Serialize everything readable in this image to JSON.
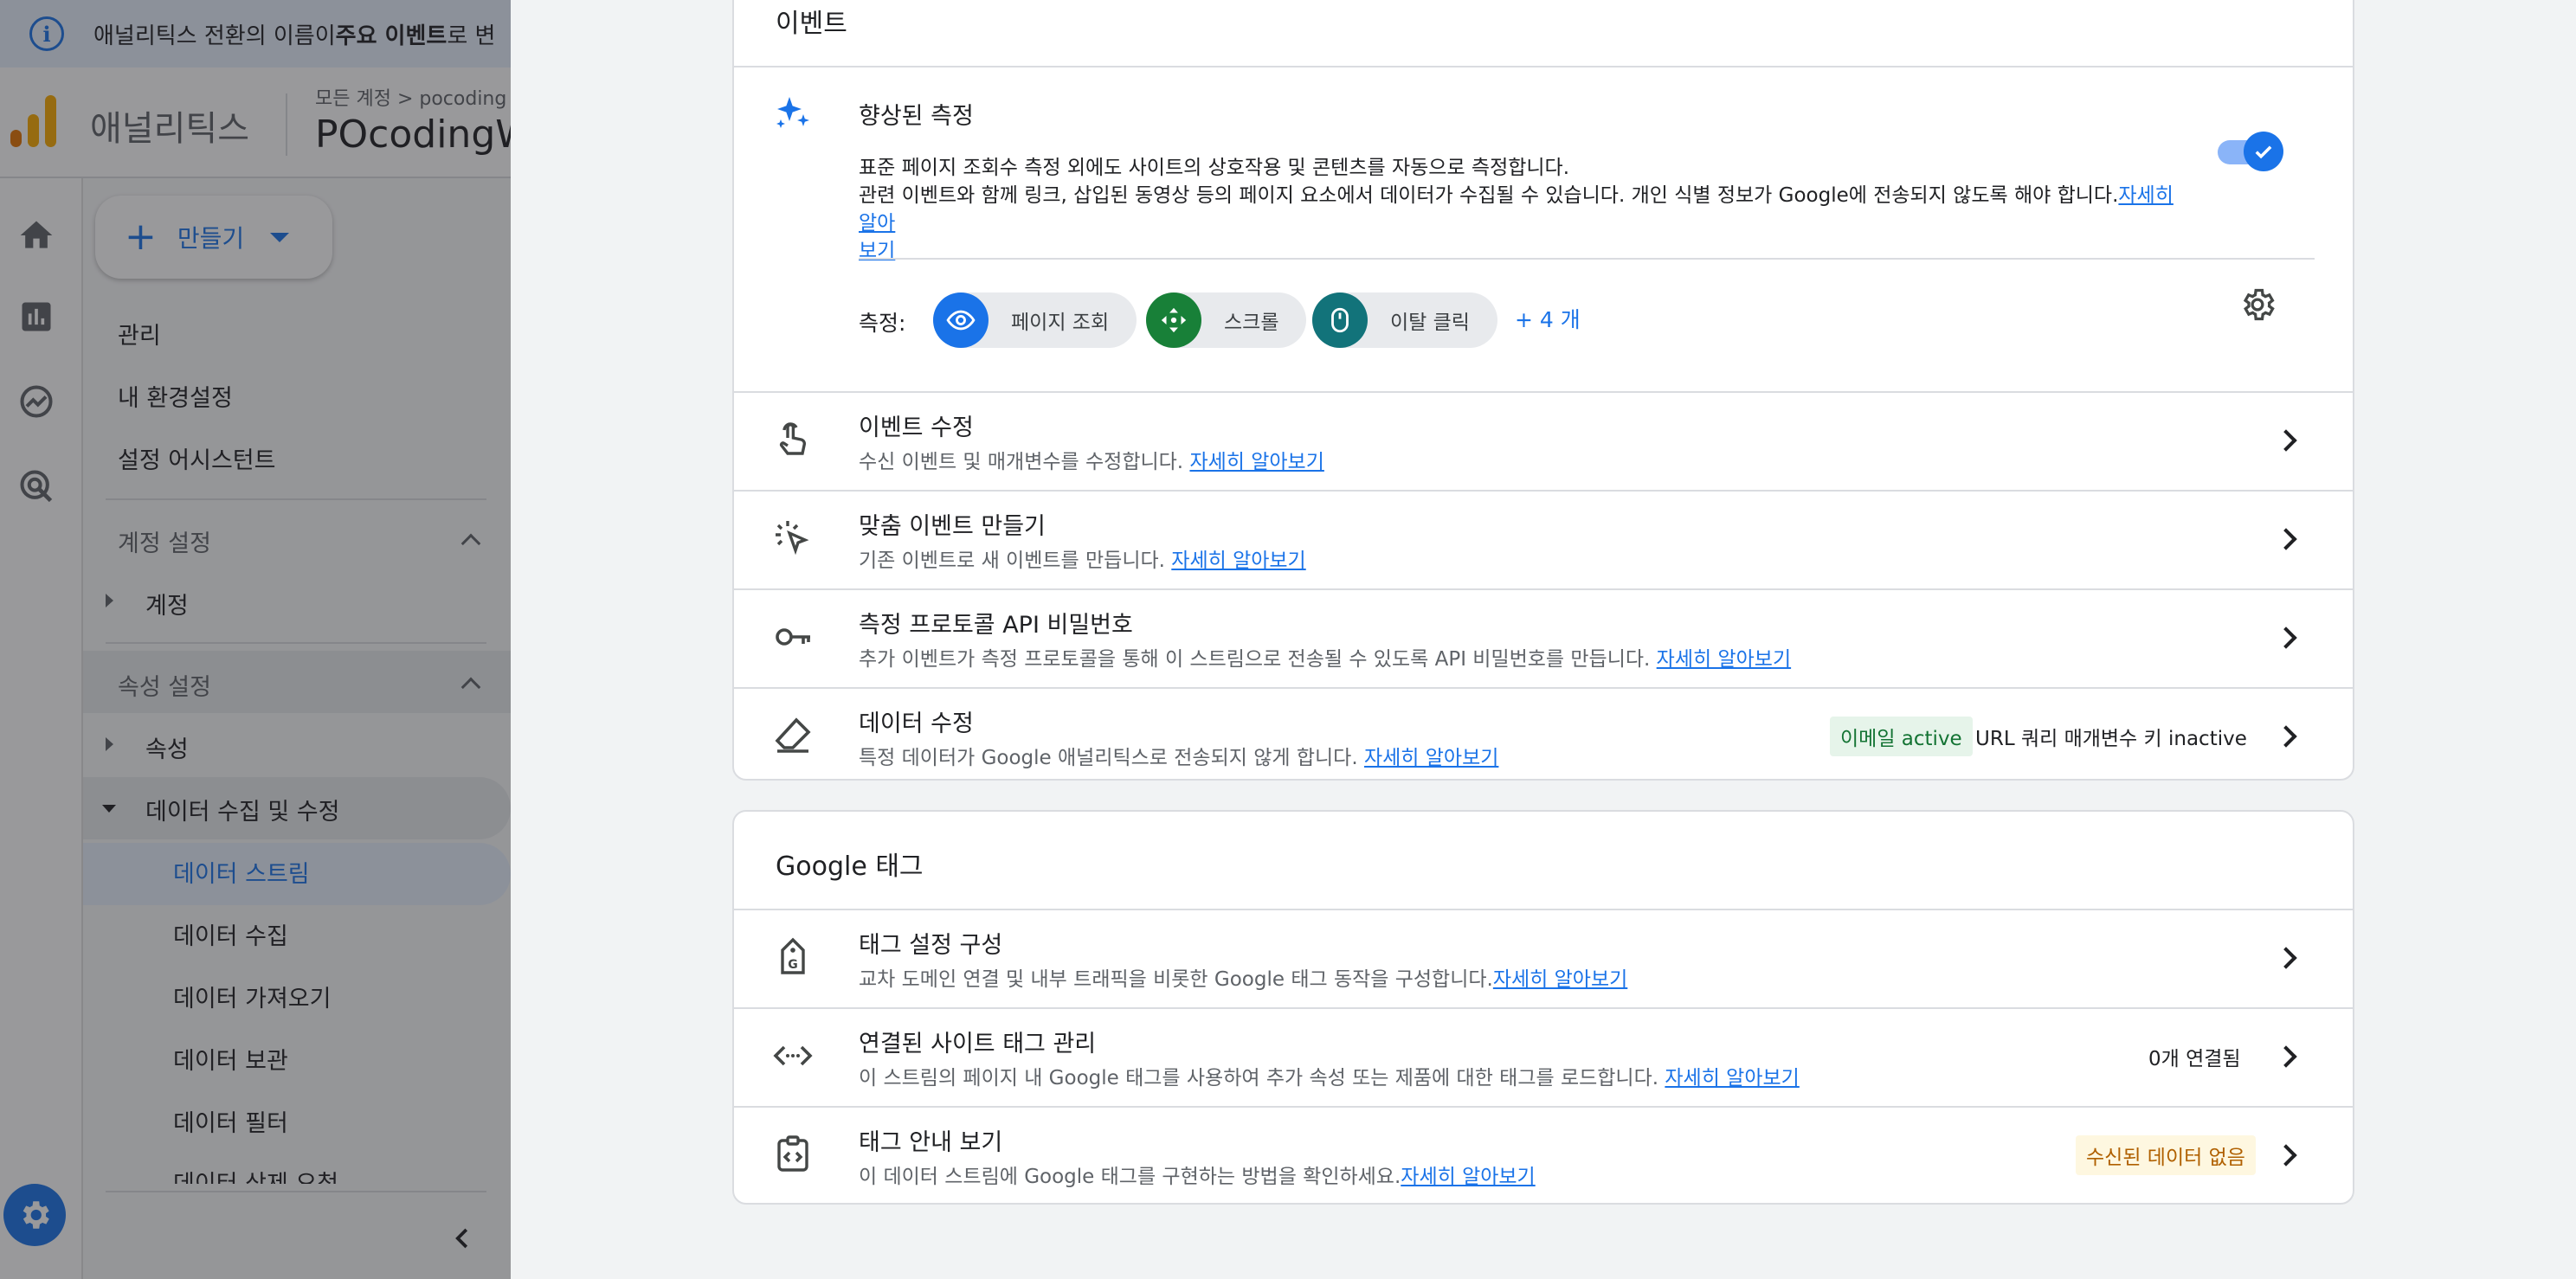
{
  "banner": {
    "prefix": "애널리틱스 전환의 이름이 ",
    "bold": "주요 이벤트",
    "suffix": "로 변"
  },
  "header": {
    "app_name": "애널리틱스",
    "breadcrumb": "모든 계정 > pocoding",
    "property_name": "POcodingW"
  },
  "sidebar": {
    "create_label": "만들기",
    "items": [
      "관리",
      "내 환경설정",
      "설정 어시스턴트"
    ],
    "account_section": {
      "title": "계정 설정",
      "items": [
        "계정"
      ]
    },
    "property_section": {
      "title": "속성 설정",
      "items": [
        "속성",
        "데이터 수집 및 수정"
      ],
      "sub_items": [
        "데이터 스트림",
        "데이터 수집",
        "데이터 가져오기",
        "데이터 보관",
        "데이터 필터",
        "데이터 삭제 요청"
      ]
    }
  },
  "events_card": {
    "title": "이벤트",
    "enhanced": {
      "title": "향상된 측정",
      "desc_line1": "표준 페이지 조회수 측정 외에도 사이트의 상호작용 및 콘텐츠를 자동으로 측정합니다.",
      "desc_line2": "관련 이벤트와 함께 링크, 삽입된 동영상 등의 페이지 요소에서 데이터가 수집될 수 있습니다. 개인 식별 정보가 Google에 전송되지 않도록 해야 합니다.",
      "link_part1": "자세히 알아",
      "link_part2": "보기",
      "toggle_on": true,
      "measure_label": "측정:",
      "chips": [
        {
          "label": "페이지 조회",
          "color": "#1a73e8"
        },
        {
          "label": "스크롤",
          "color": "#188038"
        },
        {
          "label": "이탈 클릭",
          "color": "#12737a"
        }
      ],
      "more": "+ 4 개"
    },
    "rows": [
      {
        "title": "이벤트 수정",
        "desc": "수신 이벤트 및 매개변수를 수정합니다. ",
        "link": "자세히 알아보기"
      },
      {
        "title": "맞춤 이벤트 만들기",
        "desc": "기존 이벤트로 새 이벤트를 만듭니다. ",
        "link": "자세히 알아보기"
      },
      {
        "title": "측정 프로토콜 API 비밀번호",
        "desc": "추가 이벤트가 측정 프로토콜을 통해 이 스트림으로 전송될 수 있도록 API 비밀번호를 만듭니다. ",
        "link": "자세히 알아보기"
      },
      {
        "title": "데이터 수정",
        "desc": "특정 데이터가 Google 애널리틱스로 전송되지 않게 합니다. ",
        "link": "자세히 알아보기",
        "badge1": "이메일 active",
        "badge2": "URL 쿼리 매개변수 키 inactive"
      }
    ]
  },
  "gtag_card": {
    "title": "Google 태그",
    "rows": [
      {
        "title": "태그 설정 구성",
        "desc": "교차 도메인 연결 및 내부 트래픽을 비롯한 Google 태그 동작을 구성합니다.",
        "link": "자세히 알아보기"
      },
      {
        "title": "연결된 사이트 태그 관리",
        "desc": "이 스트림의 페이지 내 Google 태그를 사용하여 추가 속성 또는 제품에 대한 태그를 로드합니다. ",
        "link": "자세히 알아보기",
        "badge": "0개 연결됨"
      },
      {
        "title": "태그 안내 보기",
        "desc": "이 데이터 스트림에 Google 태그를 구현하는 방법을 확인하세요.",
        "link": "자세히 알아보기",
        "badge": "수신된 데이터 없음"
      }
    ]
  }
}
